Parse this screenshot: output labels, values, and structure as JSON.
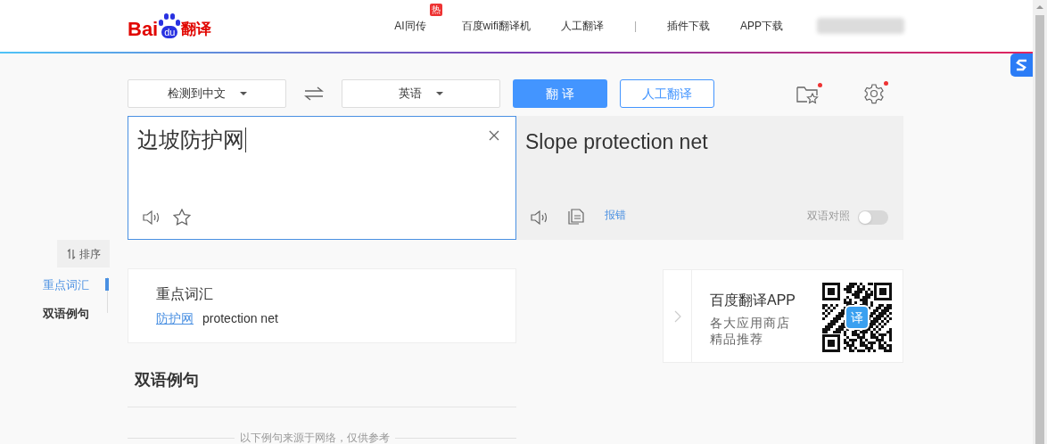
{
  "header": {
    "logo": {
      "part_1": "Bai",
      "part_2": "du",
      "part_3": "翻译"
    },
    "nav": [
      {
        "label": "AI同传",
        "badge": "热"
      },
      {
        "label": "百度wifi翻译机"
      },
      {
        "label": "人工翻译"
      },
      {
        "kind": "divider",
        "label": "|"
      },
      {
        "label": "插件下载"
      },
      {
        "label": "APP下载"
      }
    ]
  },
  "toolbar": {
    "source_language": "检测到中文",
    "target_language": "英语",
    "translate_button": "翻 译",
    "human_translate_button": "人工翻译",
    "favorites_has_dot": true,
    "settings_has_dot": true
  },
  "input": {
    "value": "边坡防护网"
  },
  "output": {
    "text": "Slope protection net",
    "report": "报错",
    "bilingual_label": "双语对照",
    "bilingual_on": false
  },
  "side_nav": {
    "sort_button": "排序",
    "items": [
      {
        "label": "重点词汇",
        "selected": true
      },
      {
        "label": "双语例句",
        "selected": false
      }
    ]
  },
  "keywords_card": {
    "title": "重点词汇",
    "entries": [
      {
        "term": "防护网",
        "meaning": "protection net"
      }
    ]
  },
  "app_card": {
    "title": "百度翻译APP",
    "lines": [
      "各大应用商店",
      "精品推荐"
    ],
    "qr_badge": "译"
  },
  "examples": {
    "title": "双语例句",
    "note": "以下例句来源于网络，仅供参考"
  }
}
